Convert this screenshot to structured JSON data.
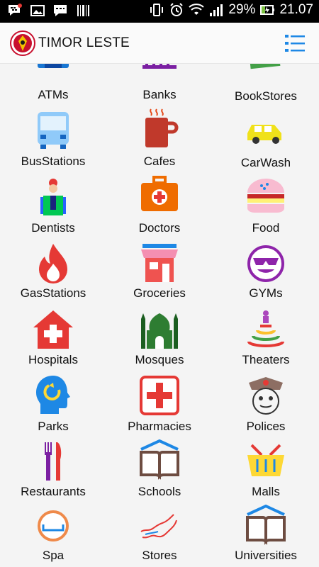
{
  "status_bar": {
    "battery_percent": "29%",
    "time": "21.07"
  },
  "app_bar": {
    "title": "TIMOR LESTE"
  },
  "categories": [
    {
      "label": "ATMs",
      "icon": "atm-icon"
    },
    {
      "label": "Banks",
      "icon": "bank-icon"
    },
    {
      "label": "BookStores",
      "icon": "books-icon"
    },
    {
      "label": "BusStations",
      "icon": "bus-icon"
    },
    {
      "label": "Cafes",
      "icon": "coffee-mug-icon"
    },
    {
      "label": "CarWash",
      "icon": "car-icon"
    },
    {
      "label": "Dentists",
      "icon": "dentist-icon"
    },
    {
      "label": "Doctors",
      "icon": "medical-kit-icon"
    },
    {
      "label": "Food",
      "icon": "burger-icon"
    },
    {
      "label": "GasStations",
      "icon": "flame-icon"
    },
    {
      "label": "Groceries",
      "icon": "store-icon"
    },
    {
      "label": "GYMs",
      "icon": "smiley-sunglasses-icon"
    },
    {
      "label": "Hospitals",
      "icon": "hospital-icon"
    },
    {
      "label": "Mosques",
      "icon": "mosque-icon"
    },
    {
      "label": "Theaters",
      "icon": "stage-icon"
    },
    {
      "label": "Parks",
      "icon": "head-refresh-icon"
    },
    {
      "label": "Pharmacies",
      "icon": "pharmacy-cross-icon"
    },
    {
      "label": "Polices",
      "icon": "police-icon"
    },
    {
      "label": "Restaurants",
      "icon": "fork-knife-icon"
    },
    {
      "label": "Schools",
      "icon": "open-book-icon"
    },
    {
      "label": "Malls",
      "icon": "basket-icon"
    },
    {
      "label": "Spa",
      "icon": "tub-icon"
    },
    {
      "label": "Stores",
      "icon": "map-outline-icon"
    },
    {
      "label": "Universities",
      "icon": "open-book-roof-icon"
    }
  ]
}
